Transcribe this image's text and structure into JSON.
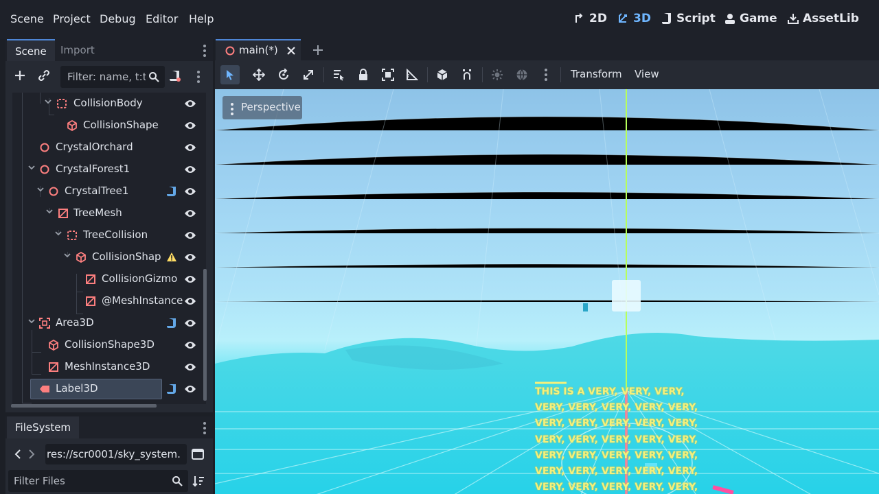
{
  "menubar": {
    "menus": [
      "Scene",
      "Project",
      "Debug",
      "Editor",
      "Help"
    ],
    "workspaces": [
      {
        "label": "2D",
        "icon": "2d-icon",
        "active": false
      },
      {
        "label": "3D",
        "icon": "3d-icon",
        "active": true
      },
      {
        "label": "Script",
        "icon": "script-icon",
        "active": false
      },
      {
        "label": "Game",
        "icon": "game-icon",
        "active": false
      },
      {
        "label": "AssetLib",
        "icon": "assetlib-icon",
        "active": false
      }
    ]
  },
  "scene_dock": {
    "tabs": [
      "Scene",
      "Import"
    ],
    "active_tab": "Scene",
    "filter_placeholder": "Filter: name, t:t",
    "nodes": [
      {
        "label": "CollisionBody",
        "icon": "staticbody-icon",
        "expanded": true,
        "script": false,
        "warning": false
      },
      {
        "label": "CollisionShape",
        "icon": "collisionshape-icon",
        "expanded": null,
        "script": false,
        "warning": false
      },
      {
        "label": "CrystalOrchard",
        "icon": "node3d-icon",
        "expanded": null,
        "script": false,
        "warning": false
      },
      {
        "label": "CrystalForest1",
        "icon": "node3d-icon",
        "expanded": true,
        "script": false,
        "warning": false
      },
      {
        "label": "CrystalTree1",
        "icon": "node3d-icon",
        "expanded": true,
        "script": true,
        "warning": false
      },
      {
        "label": "TreeMesh",
        "icon": "meshinstance-icon",
        "expanded": true,
        "script": false,
        "warning": false
      },
      {
        "label": "TreeCollision",
        "icon": "staticbody-icon",
        "expanded": true,
        "script": false,
        "warning": false
      },
      {
        "label": "CollisionShap",
        "icon": "collisionshape-icon",
        "expanded": true,
        "script": false,
        "warning": true
      },
      {
        "label": "CollisionGizmo",
        "icon": "meshinstance-icon",
        "expanded": null,
        "script": false,
        "warning": false
      },
      {
        "label": "@MeshInstance",
        "icon": "meshinstance-icon",
        "expanded": null,
        "script": false,
        "warning": false
      },
      {
        "label": "Area3D",
        "icon": "area3d-icon",
        "expanded": true,
        "script": true,
        "warning": false
      },
      {
        "label": "CollisionShape3D",
        "icon": "collisionshape-icon",
        "expanded": null,
        "script": false,
        "warning": false
      },
      {
        "label": "MeshInstance3D",
        "icon": "meshinstance-icon",
        "expanded": null,
        "script": false,
        "warning": false
      },
      {
        "label": "Label3D",
        "icon": "label3d-icon",
        "expanded": null,
        "script": true,
        "warning": false,
        "selected": true
      }
    ]
  },
  "filesystem_dock": {
    "tab": "FileSystem",
    "path": "res://scr0001/sky_system.",
    "filter_placeholder": "Filter Files"
  },
  "editor": {
    "open_tab": "main(*)",
    "viewport_menus": [
      "Transform",
      "View"
    ],
    "perspective_label": "Perspective",
    "label3d_text": "THIS IS A VERY, VERY, VERY,\nVERY, VERY, VERY, VERY, VERY,\nVERY, VERY, VERY, VERY, VERY,\nVERY, VERY, VERY, VERY, VERY,\nVERY, VERY, VERY, VERY, VERY,\nVERY, VERY, VERY, VERY, VERY,\nVERY, VERY, VERY, VERY, VERY,"
  },
  "colors": {
    "accent": "#6fb6ff",
    "node_icon_red": "#fc7f7f",
    "script_icon": "#63a7e6",
    "warning": "#ffdd65",
    "label3d_text": "#f5f07a"
  }
}
